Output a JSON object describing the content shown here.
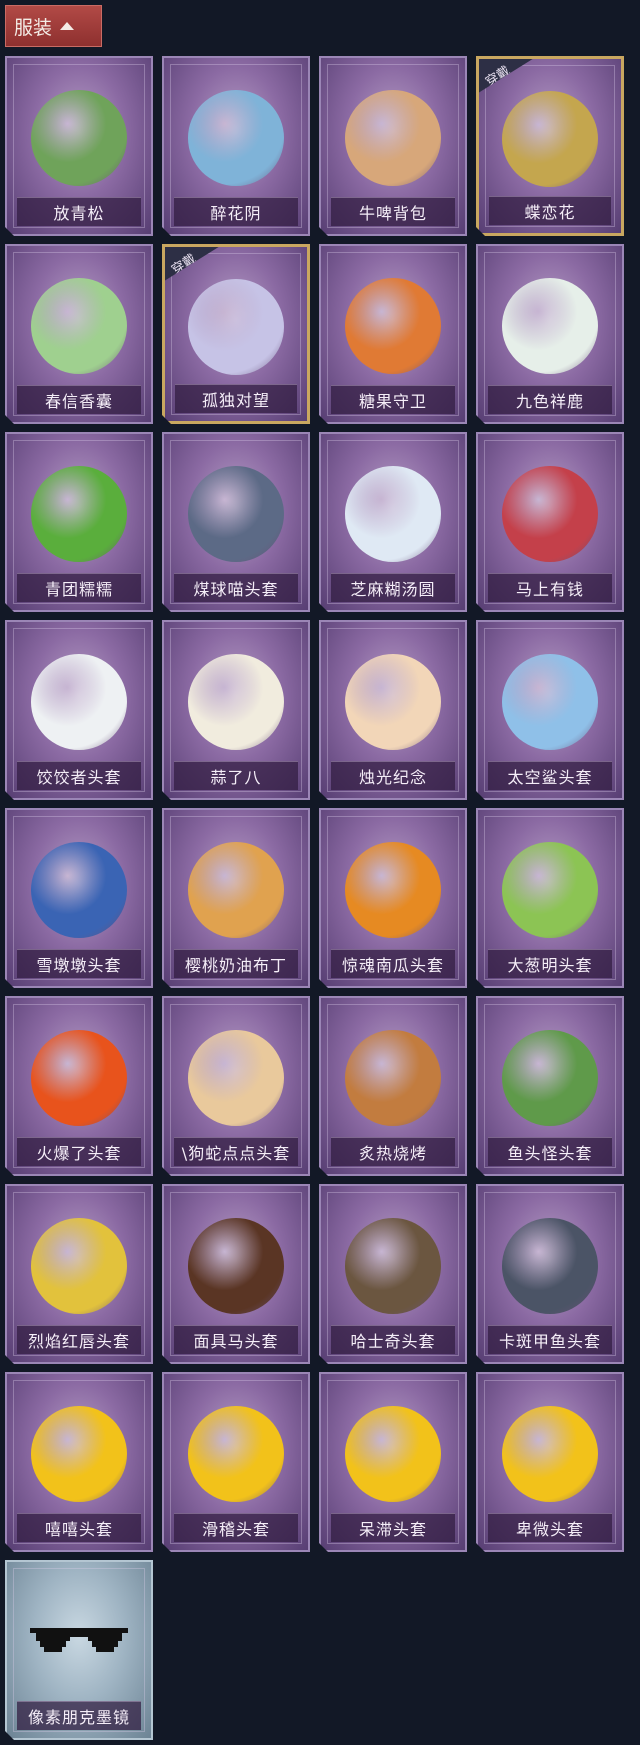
{
  "header": {
    "section_label": "服装"
  },
  "equipped_badge": "穿戴",
  "items": [
    {
      "label": "放青松",
      "equipped": false,
      "color": "#6fa35a"
    },
    {
      "label": "醉花阴",
      "equipped": false,
      "color": "#7fb3d8"
    },
    {
      "label": "牛啤背包",
      "equipped": false,
      "color": "#d7a77a"
    },
    {
      "label": "蝶恋花",
      "equipped": true,
      "color": "#c4a64e"
    },
    {
      "label": "春信香囊",
      "equipped": false,
      "color": "#9fd08f"
    },
    {
      "label": "孤独对望",
      "equipped": true,
      "color": "#c6c3e6"
    },
    {
      "label": "糖果守卫",
      "equipped": false,
      "color": "#e07a34"
    },
    {
      "label": "九色祥鹿",
      "equipped": false,
      "color": "#e6efe9"
    },
    {
      "label": "青团糯糯",
      "equipped": false,
      "color": "#5aae3c"
    },
    {
      "label": "煤球喵头套",
      "equipped": false,
      "color": "#5c6a86"
    },
    {
      "label": "芝麻糊汤圆",
      "equipped": false,
      "color": "#dfe9f4"
    },
    {
      "label": "马上有钱",
      "equipped": false,
      "color": "#c4404a"
    },
    {
      "label": "饺饺者头套",
      "equipped": false,
      "color": "#eef1f3"
    },
    {
      "label": "蒜了八",
      "equipped": false,
      "color": "#f1ecde"
    },
    {
      "label": "烛光纪念",
      "equipped": false,
      "color": "#f2d6b8"
    },
    {
      "label": "太空鲨头套",
      "equipped": false,
      "color": "#8fc0e8"
    },
    {
      "label": "雪墩墩头套",
      "equipped": false,
      "color": "#3a64b4"
    },
    {
      "label": "樱桃奶油布丁",
      "equipped": false,
      "color": "#e0a24f"
    },
    {
      "label": "惊魂南瓜头套",
      "equipped": false,
      "color": "#e68a22"
    },
    {
      "label": "大葱明头套",
      "equipped": false,
      "color": "#8cc454"
    },
    {
      "label": "火爆了头套",
      "equipped": false,
      "color": "#e8531c"
    },
    {
      "label": "\\狗蛇点点头套",
      "equipped": false,
      "color": "#e9c99c"
    },
    {
      "label": "炙热烧烤",
      "equipped": false,
      "color": "#c27c3f"
    },
    {
      "label": "鱼头怪头套",
      "equipped": false,
      "color": "#5f9a4a"
    },
    {
      "label": "烈焰红唇头套",
      "equipped": false,
      "color": "#e2c23c"
    },
    {
      "label": "面具马头套",
      "equipped": false,
      "color": "#5a3524"
    },
    {
      "label": "哈士奇头套",
      "equipped": false,
      "color": "#6b5640"
    },
    {
      "label": "卡斑甲鱼头套",
      "equipped": false,
      "color": "#4b5466"
    },
    {
      "label": "嘻嘻头套",
      "equipped": false,
      "color": "#f2c21a"
    },
    {
      "label": "滑稽头套",
      "equipped": false,
      "color": "#f2c21a"
    },
    {
      "label": "呆滞头套",
      "equipped": false,
      "color": "#f2c21a"
    },
    {
      "label": "卑微头套",
      "equipped": false,
      "color": "#f2c21a"
    },
    {
      "label": "像素朋克墨镜",
      "equipped": false,
      "color": "#111111",
      "rarity": "blue",
      "icon": "pixel-sunglasses-icon"
    }
  ]
}
